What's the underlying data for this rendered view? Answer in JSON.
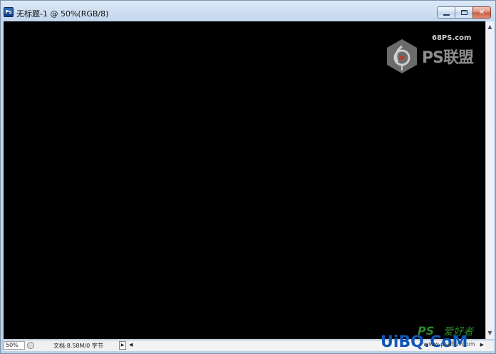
{
  "window": {
    "title": "无标题-1 @ 50%(RGB/8)",
    "app_icon_label": "Ps",
    "close_glyph": "✕"
  },
  "canvas": {
    "background": "#000000",
    "watermark_site": "68PS.com",
    "watermark_text": "PS联盟"
  },
  "status": {
    "zoom": "50%",
    "doc_info": "文档:8.58M/0 字节",
    "arrow": "▶"
  },
  "scroll": {
    "up_arrow": "▲",
    "down_arrow": "▼",
    "left_arrow": "◀",
    "right_arrow": "▶"
  },
  "site_watermark": {
    "ps": "PS",
    "cn": "爱好者",
    "logo": "UiBQ.CoM",
    "url": "www.psahz.com"
  }
}
